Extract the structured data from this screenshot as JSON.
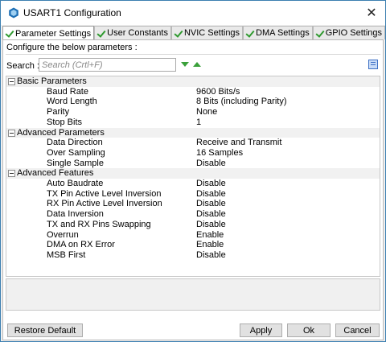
{
  "window": {
    "title": "USART1 Configuration",
    "close_glyph": "✕"
  },
  "tabs": [
    {
      "label": "Parameter Settings",
      "active": true
    },
    {
      "label": "User Constants",
      "active": false
    },
    {
      "label": "NVIC Settings",
      "active": false
    },
    {
      "label": "DMA Settings",
      "active": false
    },
    {
      "label": "GPIO Settings",
      "active": false
    }
  ],
  "instructions": "Configure the below parameters :",
  "search": {
    "label": "Search :",
    "placeholder": "Search (Crtl+F)"
  },
  "groups": [
    {
      "label": "Basic Parameters",
      "params": [
        {
          "name": "Baud Rate",
          "value": "9600 Bits/s"
        },
        {
          "name": "Word Length",
          "value": "8 Bits (including Parity)"
        },
        {
          "name": "Parity",
          "value": "None"
        },
        {
          "name": "Stop Bits",
          "value": "1"
        }
      ]
    },
    {
      "label": "Advanced Parameters",
      "params": [
        {
          "name": "Data Direction",
          "value": "Receive and Transmit"
        },
        {
          "name": "Over Sampling",
          "value": "16 Samples"
        },
        {
          "name": "Single Sample",
          "value": "Disable"
        }
      ]
    },
    {
      "label": "Advanced Features",
      "params": [
        {
          "name": "Auto Baudrate",
          "value": "Disable"
        },
        {
          "name": "TX Pin Active Level Inversion",
          "value": "Disable"
        },
        {
          "name": "RX Pin Active Level Inversion",
          "value": "Disable"
        },
        {
          "name": "Data Inversion",
          "value": "Disable"
        },
        {
          "name": "TX and RX Pins Swapping",
          "value": "Disable"
        },
        {
          "name": "Overrun",
          "value": "Enable"
        },
        {
          "name": "DMA on RX Error",
          "value": "Enable"
        },
        {
          "name": "MSB First",
          "value": "Disable"
        }
      ]
    }
  ],
  "buttons": {
    "restore_default": "Restore Default",
    "apply": "Apply",
    "ok": "Ok",
    "cancel": "Cancel"
  },
  "colors": {
    "accent": "#3c7fb1",
    "check_green": "#2f9a2f",
    "arrow_green": "#3aa03a"
  }
}
